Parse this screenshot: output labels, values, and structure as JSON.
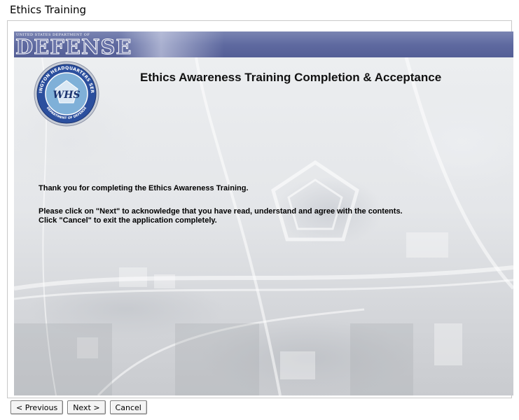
{
  "window": {
    "title": "Ethics Training"
  },
  "banner": {
    "small_text": "United States Department of",
    "word": "DEFENSE"
  },
  "seal": {
    "top_arc": "WASHINGTON HEADQUARTERS SERVICES",
    "bottom_arc": "DEPARTMENT OF DEFENSE",
    "center": "WHS"
  },
  "main": {
    "headline": "Ethics Awareness Training Completion & Acceptance",
    "thanks": "Thank you for completing the Ethics Awareness Training.",
    "instruction_next": "Please click on \"Next\" to acknowledge that you have read, understand and agree with the contents.",
    "instruction_cancel": "Click \"Cancel\" to exit the application completely."
  },
  "buttons": {
    "previous": "< Previous",
    "next": "Next >",
    "cancel": "Cancel"
  },
  "colors": {
    "banner": "#5f6aa0",
    "seal_ring": "#2b4f9e",
    "seal_center": "#7fb0d8"
  }
}
